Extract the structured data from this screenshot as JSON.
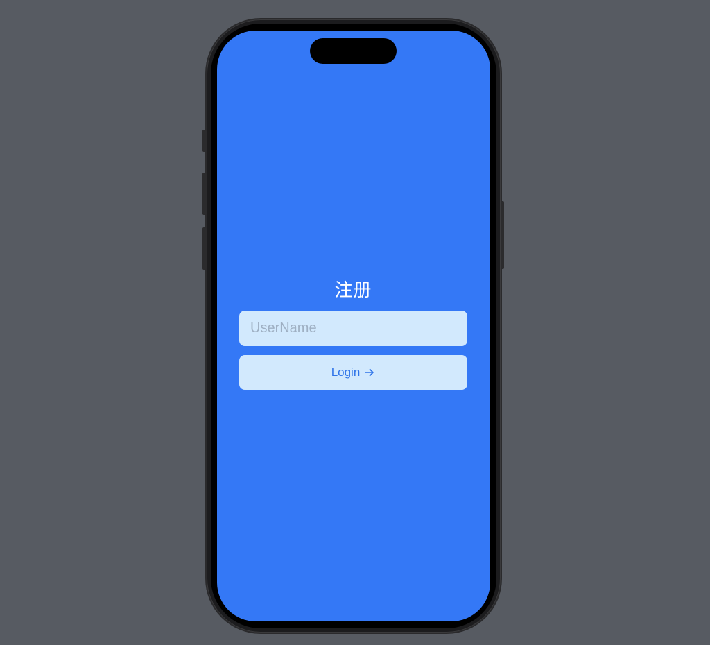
{
  "screen": {
    "title": "注册",
    "username": {
      "value": "",
      "placeholder": "UserName"
    },
    "login_button": {
      "label": "Login",
      "icon": "arrow-right-icon"
    }
  },
  "colors": {
    "background": "#575b62",
    "screen": "#3478f6",
    "field": "#d2e9fd",
    "button_text": "#2f74e8",
    "title_text": "#ffffff"
  }
}
